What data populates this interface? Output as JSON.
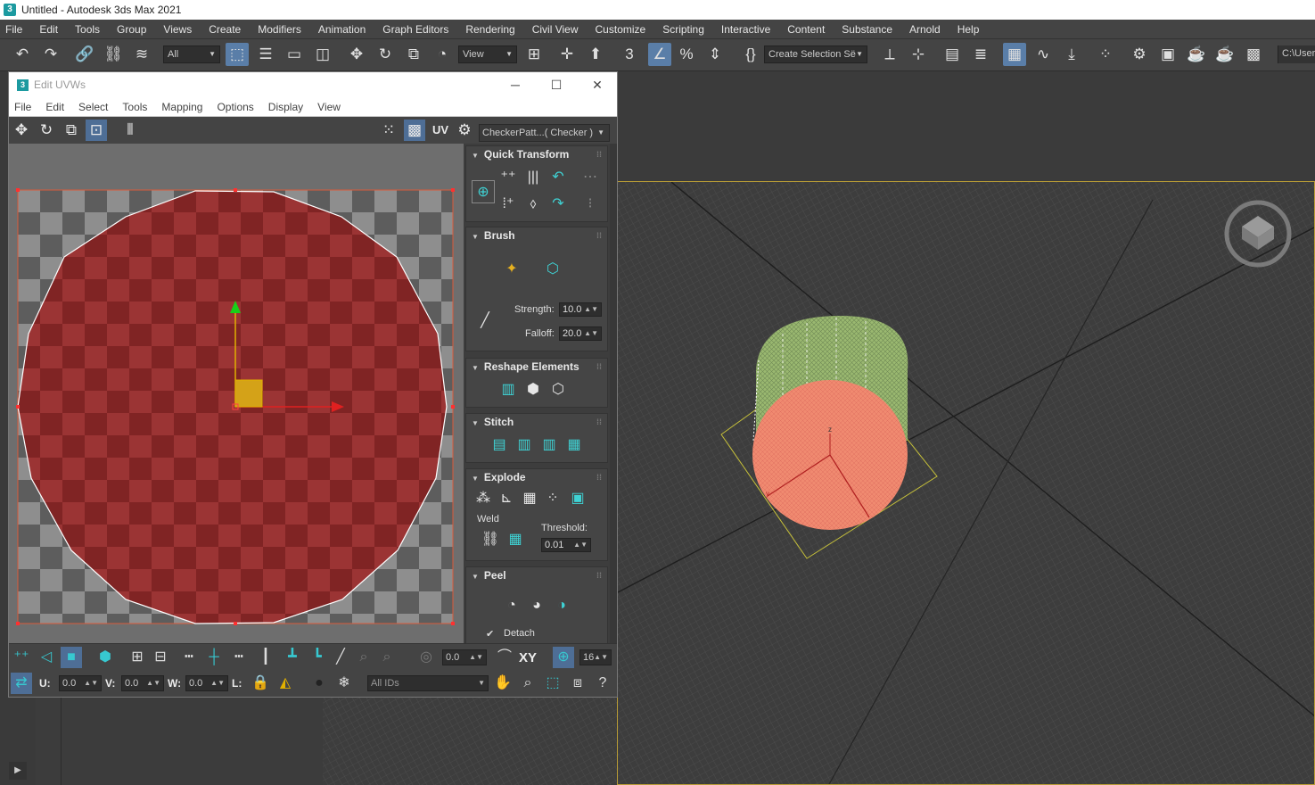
{
  "window": {
    "title": "Untitled - Autodesk 3ds Max 2021",
    "app_icon": "3"
  },
  "menubar": [
    "File",
    "Edit",
    "Tools",
    "Group",
    "Views",
    "Create",
    "Modifiers",
    "Animation",
    "Graph Editors",
    "Rendering",
    "Civil View",
    "Customize",
    "Scripting",
    "Interactive",
    "Content",
    "Substance",
    "Arnold",
    "Help"
  ],
  "toolbar": {
    "selection_filter": "All",
    "ref_coord": "View",
    "selection_set": "Create Selection Së",
    "path": "C:\\User"
  },
  "edit_uvws": {
    "title": "Edit UVWs",
    "menu": [
      "File",
      "Edit",
      "Select",
      "Tools",
      "Mapping",
      "Options",
      "Display",
      "View"
    ],
    "uv_label": "UV",
    "texture_dropdown": "CheckerPatt...( Checker )"
  },
  "panel": {
    "quick_transform": "Quick Transform",
    "brush": "Brush",
    "strength_label": "Strength:",
    "strength_value": "10.0",
    "falloff_label": "Falloff:",
    "falloff_value": "20.0",
    "reshape": "Reshape Elements",
    "stitch": "Stitch",
    "explode": "Explode",
    "weld_label": "Weld",
    "threshold_label": "Threshold:",
    "threshold_value": "0.01",
    "peel": "Peel",
    "detach_label": "Detach",
    "detach_checked": true
  },
  "bottom": {
    "rotate_value": "0.0",
    "xy_label": "XY",
    "grid_value": "16",
    "u_label": "U:",
    "u_value": "0.0",
    "v_label": "V:",
    "v_value": "0.0",
    "w_label": "W:",
    "w_value": "0.0",
    "l_label": "L:",
    "ids_value": "All IDs"
  },
  "colors": {
    "accent": "#5a7ea8",
    "teal": "#37c8d0",
    "uv_fill": "#8b2c2c",
    "cap": "#f08a70",
    "cylinder": "#9ab870"
  }
}
